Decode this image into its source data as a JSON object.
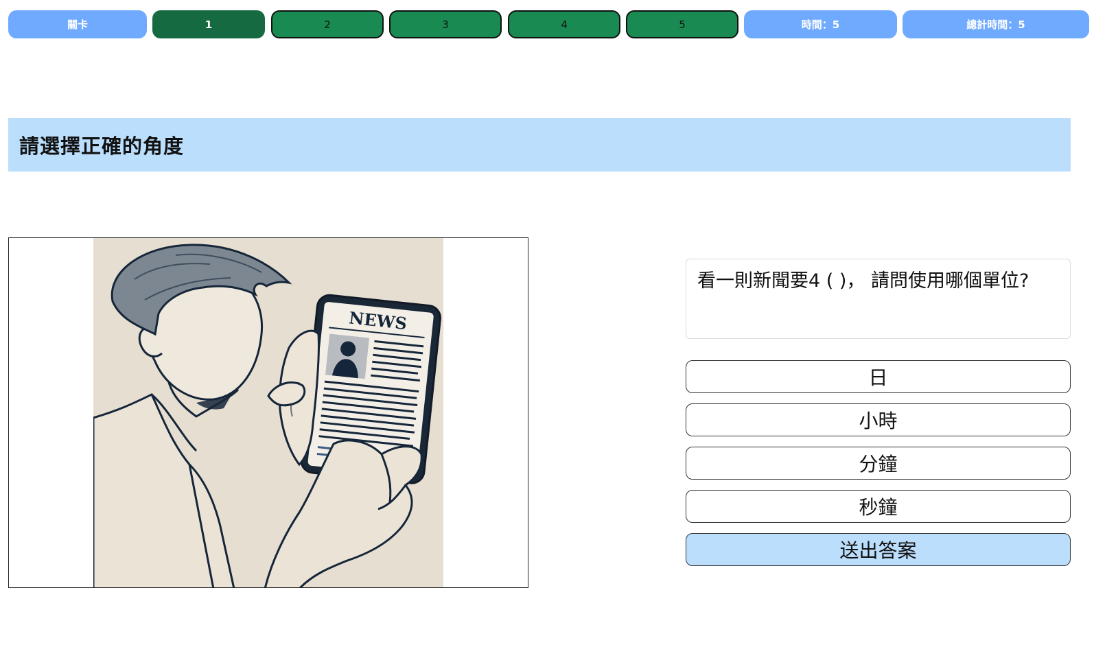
{
  "topbar": {
    "level_label": "關卡",
    "levels": [
      "1",
      "2",
      "3",
      "4",
      "5"
    ],
    "current_level": "1",
    "time_label": "時間：5",
    "total_time_label": "總計時間：5"
  },
  "instruction": "請選擇正確的角度",
  "illustration": {
    "news_label": "NEWS"
  },
  "question": "看一則新聞要4 ( )， 請問使用哪個單位?",
  "options": [
    "日",
    "小時",
    "分鐘",
    "秒鐘"
  ],
  "submit_label": "送出答案",
  "colors": {
    "info_pill": "#70aaff",
    "level_pill": "#188a52",
    "current_level_pill": "#156a42",
    "banner": "#bbdefc",
    "submit": "#bbdefc"
  }
}
